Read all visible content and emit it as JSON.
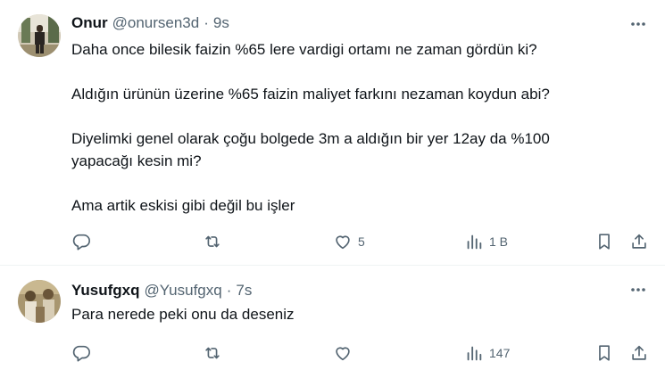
{
  "tweets": [
    {
      "name": "Onur",
      "handle": "@onursen3d",
      "separator": "·",
      "time": "9s",
      "paragraphs": [
        "Daha once bilesik faizin %65 lere vardigi ortamı ne zaman gördün ki?",
        "Aldığın ürünün üzerine %65 faizin maliyet farkını nezaman koydun abi?",
        "Diyelimki genel olarak çoğu bolgede 3m a aldığın bir yer 12ay da %100\nyapacağı kesin mi?",
        "Ama artik eskisi gibi değil bu işler"
      ],
      "likes": "5",
      "views": "1 B"
    },
    {
      "name": "Yusufgxq",
      "handle": "@Yusufgxq",
      "separator": "·",
      "time": "7s",
      "paragraphs": [
        "Para nerede peki onu da deseniz"
      ],
      "likes": "",
      "views": "147"
    }
  ],
  "icons": {
    "reply": "reply-icon",
    "retweet": "retweet-icon",
    "like": "heart-icon",
    "views": "views-chart-icon",
    "bookmark": "bookmark-icon",
    "share": "share-icon",
    "more": "more-dots-icon"
  },
  "colors": {
    "text": "#0f1419",
    "secondary": "#536471",
    "divider": "#eff3f4"
  }
}
